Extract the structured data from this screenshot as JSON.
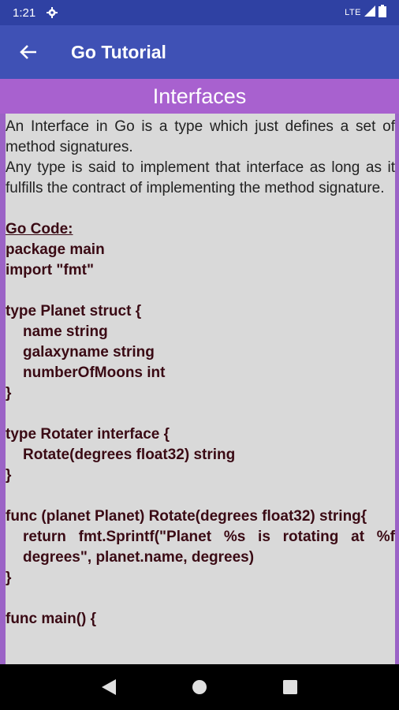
{
  "status_bar": {
    "time": "1:21",
    "network": "LTE"
  },
  "app_bar": {
    "title": "Go Tutorial"
  },
  "page": {
    "title": "Interfaces"
  },
  "content": {
    "intro_lines": [
      "An Interface in Go is a type which just defines a set of method signatures.",
      "Any type is said to implement that interface as long as it fulfills the contract of implementing the method signature."
    ],
    "code_heading": "Go Code:",
    "code": {
      "l1": "package main",
      "l2": "import \"fmt\"",
      "l3": "type Planet struct {",
      "l4": "name string",
      "l5": "galaxyname string",
      "l6": "numberOfMoons int",
      "l7": "}",
      "l8": "type Rotater interface {",
      "l9": "Rotate(degrees float32) string",
      "l10": "}",
      "l11": "func (planet Planet) Rotate(degrees float32) string{",
      "l12": "return fmt.Sprintf(\"Planet %s is rotating at %f degrees\", planet.name, degrees)",
      "l13": "}",
      "l14": "func main() {"
    }
  },
  "icons": {
    "status": [
      "gear-icon",
      "signal-icon",
      "battery-icon"
    ],
    "nav": [
      "back-triangle-icon",
      "home-circle-icon",
      "recents-square-icon"
    ]
  },
  "colors": {
    "status_bar": "#2f41a3",
    "app_bar": "#3f51b5",
    "page_title_bar": "#a861cf",
    "content_bg": "#d9d9d9",
    "code_text": "#3a0a14"
  }
}
